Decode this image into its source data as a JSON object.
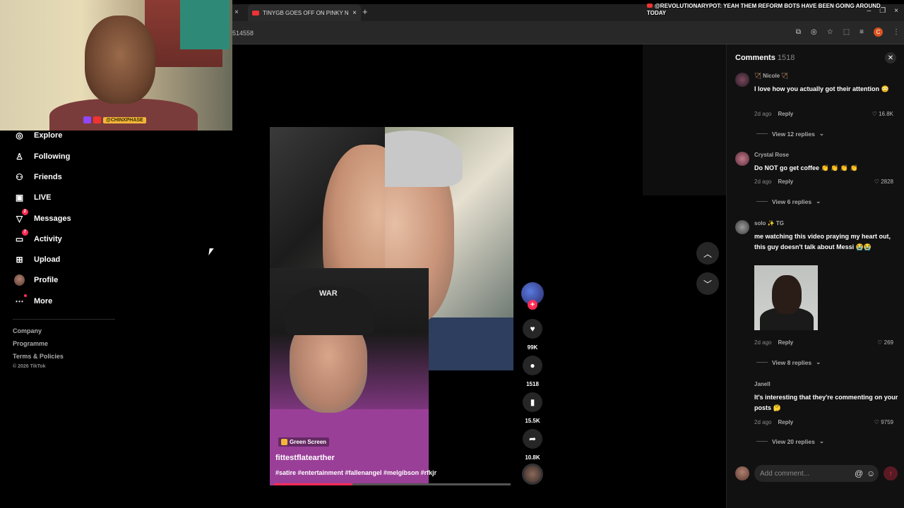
{
  "browser": {
    "tab_title": "TINYGB GOES OFF ON PINKY N",
    "url_fragment": "514558",
    "new_tab": "+",
    "close": "×",
    "profile_initial": "C"
  },
  "overlay": {
    "ticker": "@REVOLUTIONARYPOT: YEAH THEM REFORM BOTS HAVE BEEN GOING AROUND TODAY",
    "streamer_handle": "@CHINXPHASE"
  },
  "sidebar": {
    "items": [
      {
        "label": "Explore",
        "icon": "compass-icon"
      },
      {
        "label": "Following",
        "icon": "user-follow-icon"
      },
      {
        "label": "Friends",
        "icon": "friends-icon"
      },
      {
        "label": "LIVE",
        "icon": "live-tv-icon"
      },
      {
        "label": "Messages",
        "icon": "message-send-icon",
        "badge": "2"
      },
      {
        "label": "Activity",
        "icon": "activity-inbox-icon",
        "badge": "7"
      },
      {
        "label": "Upload",
        "icon": "upload-plus-icon"
      },
      {
        "label": "Profile",
        "icon": "avatar"
      },
      {
        "label": "More",
        "icon": "more-dots-icon"
      }
    ],
    "footer": {
      "company": "Company",
      "programme": "Programme",
      "terms": "Terms & Policies",
      "copyright": "© 2026 TikTok"
    }
  },
  "video": {
    "effect_tag": "Green Screen",
    "author": "fittestflatearther",
    "hashtags": "#satire #entertainment #fallenangel #melgibson #rfkjr",
    "cap_text": "WAR",
    "progress": 0.33,
    "stats": {
      "likes": "99K",
      "comments": "1518",
      "saves": "15.5K",
      "shares": "10.8K"
    },
    "follow": "+"
  },
  "comments": {
    "title": "Comments",
    "count": "1518",
    "input_placeholder": "Add comment...",
    "list": [
      {
        "user": "🏹 Nicole 🏹",
        "text": "I love how you actually got their attention 😳",
        "age": "2d ago",
        "reply": "Reply",
        "likes": "16.8K",
        "replies": "View 12 replies"
      },
      {
        "user": "Crystal Rose",
        "text": "Do NOT go get coffee 👏 👏 👏 👏",
        "age": "2d ago",
        "reply": "Reply",
        "likes": "2828",
        "replies": "View 6 replies"
      },
      {
        "user": "solo ✨ TG",
        "text": "me watching this video praying my heart out, this guy doesn't talk about Messi 😭😭",
        "age": "2d ago",
        "reply": "Reply",
        "likes": "269",
        "replies": "View 8 replies"
      },
      {
        "user": "Janell",
        "text": "It's interesting that they're commenting on your posts 🤔",
        "age": "2d ago",
        "reply": "Reply",
        "likes": "9759",
        "replies": "View 20 replies"
      }
    ]
  }
}
